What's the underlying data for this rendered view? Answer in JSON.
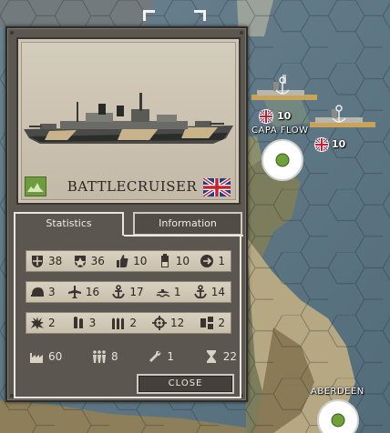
{
  "map": {
    "cities": [
      {
        "name": "CAPA FLOW"
      },
      {
        "name": "ABERDEEN"
      }
    ],
    "fleet_counts": [
      "10",
      "10"
    ]
  },
  "unit": {
    "name": "BATTLECRUISER",
    "nation_flag": "united-kingdom-flag",
    "terrain_icon": "sea-terrain-icon"
  },
  "tabs": {
    "statistics": "Statistics",
    "information": "Information"
  },
  "stats": {
    "row1": [
      {
        "icon": "soft-attack-icon",
        "value": "38"
      },
      {
        "icon": "hard-attack-icon",
        "value": "36"
      },
      {
        "icon": "morale-icon",
        "value": "10"
      },
      {
        "icon": "fuel-icon",
        "value": "10"
      },
      {
        "icon": "range-icon",
        "value": "1"
      }
    ],
    "row2": [
      {
        "icon": "ground-defense-icon",
        "value": "3"
      },
      {
        "icon": "air-attack-icon",
        "value": "16"
      },
      {
        "icon": "naval-attack-icon",
        "value": "17"
      },
      {
        "icon": "submarine-attack-icon",
        "value": "1"
      },
      {
        "icon": "naval-defense-icon",
        "value": "14"
      }
    ],
    "row3": [
      {
        "icon": "explosion-icon",
        "value": "2"
      },
      {
        "icon": "ammo-icon",
        "value": "3"
      },
      {
        "icon": "shells-icon",
        "value": "2"
      },
      {
        "icon": "target-icon",
        "value": "12"
      },
      {
        "icon": "spotting-icon",
        "value": "2"
      }
    ],
    "bottom": [
      {
        "icon": "factory-icon",
        "value": "60"
      },
      {
        "icon": "crew-icon",
        "value": "8"
      },
      {
        "icon": "wrench-icon",
        "value": "1"
      },
      {
        "icon": "hourglass-icon",
        "value": "22"
      }
    ]
  },
  "buttons": {
    "close": "CLOSE"
  }
}
